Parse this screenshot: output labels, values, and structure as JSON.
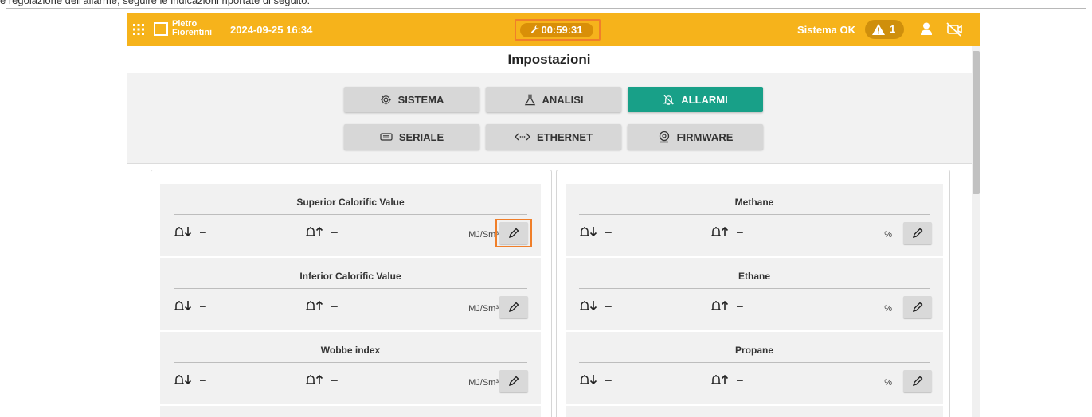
{
  "caption": "e regolazione dell'allarme, seguire le indicazioni riportate di seguito:",
  "topbar": {
    "brand_line1": "Pietro",
    "brand_line2": "Fiorentini",
    "datetime": "2024-09-25 16:34",
    "timer": "00:59:31",
    "status": "Sistema OK",
    "alert_count": "1",
    "bg_color": "#f6b31b"
  },
  "page": {
    "title": "Impostazioni"
  },
  "tabs": [
    {
      "label": "SISTEMA",
      "icon": "gear-icon",
      "active": false
    },
    {
      "label": "ANALISI",
      "icon": "flask-icon",
      "active": false
    },
    {
      "label": "ALLARMI",
      "icon": "bell-icon",
      "active": true
    },
    {
      "label": "SERIALE",
      "icon": "serial-icon",
      "active": false
    },
    {
      "label": "ETHERNET",
      "icon": "ethernet-icon",
      "active": false
    },
    {
      "label": "FIRMWARE",
      "icon": "firmware-icon",
      "active": false
    }
  ],
  "accent_color": "#18a088",
  "alarms_left": [
    {
      "name": "Superior Calorific Value",
      "low": "–",
      "high": "–",
      "unit": "MJ/Sm³"
    },
    {
      "name": "Inferior Calorific Value",
      "low": "–",
      "high": "–",
      "unit": "MJ/Sm³"
    },
    {
      "name": "Wobbe index",
      "low": "–",
      "high": "–",
      "unit": "MJ/Sm³"
    }
  ],
  "alarms_right": [
    {
      "name": "Methane",
      "low": "–",
      "high": "–",
      "unit": "%"
    },
    {
      "name": "Ethane",
      "low": "–",
      "high": "–",
      "unit": "%"
    },
    {
      "name": "Propane",
      "low": "–",
      "high": "–",
      "unit": "%"
    }
  ]
}
